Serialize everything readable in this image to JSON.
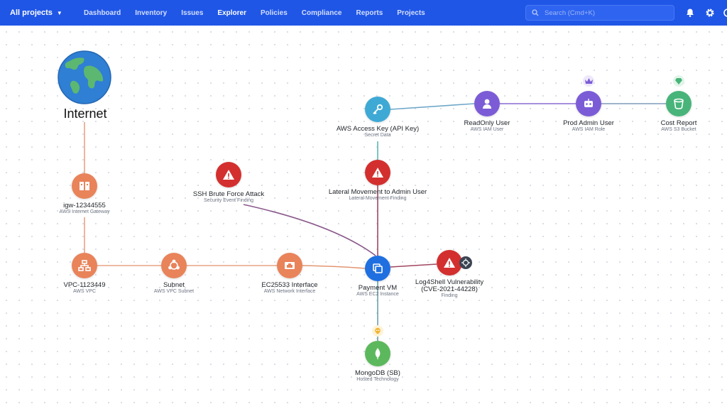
{
  "topbar": {
    "project_selector": "All projects",
    "nav": [
      "Dashboard",
      "Inventory",
      "Issues",
      "Explorer",
      "Policies",
      "Compliance",
      "Reports",
      "Projects"
    ],
    "active_nav": "Explorer",
    "search_placeholder": "Search (Cmd+K)",
    "colors": {
      "bar": "#1f56e6"
    }
  },
  "graph": {
    "internet": {
      "label": "Internet"
    },
    "nodes": {
      "igw": {
        "label": "igw-12344555",
        "sub": "AWS Internet Gateway"
      },
      "vpc": {
        "label": "VPC-1123449",
        "sub": "AWS VPC"
      },
      "subnet": {
        "label": "Subnet",
        "sub": "AWS VPC Subnet"
      },
      "eni": {
        "label": "EC25533 Interface",
        "sub": "AWS Network Interface"
      },
      "vm": {
        "label": "Payment VM",
        "sub": "AWS EC2 Instance"
      },
      "log4shell": {
        "label": "Log4Shell Vulnerability",
        "label2": "(CVE-2021-44228)",
        "sub": "Finding"
      },
      "mongo": {
        "label": "MongoDB (SB)",
        "sub": "Hosted Technology"
      },
      "ssh": {
        "label": "SSH Brute Force Attack",
        "sub": "Security Event Finding"
      },
      "lateral": {
        "label": "Lateral Movement to Admin User",
        "sub": "Lateral Movement Finding"
      },
      "key": {
        "label": "AWS Access Key (API Key)",
        "sub": "Secret Data"
      },
      "readonly": {
        "label": "ReadOnly User",
        "sub": "AWS IAM User"
      },
      "admin": {
        "label": "Prod Admin User",
        "sub": "AWS IAM Role"
      },
      "cost": {
        "label": "Cost Report",
        "sub": "AWS S3 Bucket"
      }
    },
    "colors": {
      "network": "#e9835a",
      "finding": "#d32f2f",
      "vm": "#1f6fe0",
      "key": "#3fa9d5",
      "identity": "#7b5cd6",
      "bucket": "#48b47a",
      "mongo": "#5cb85c"
    }
  }
}
